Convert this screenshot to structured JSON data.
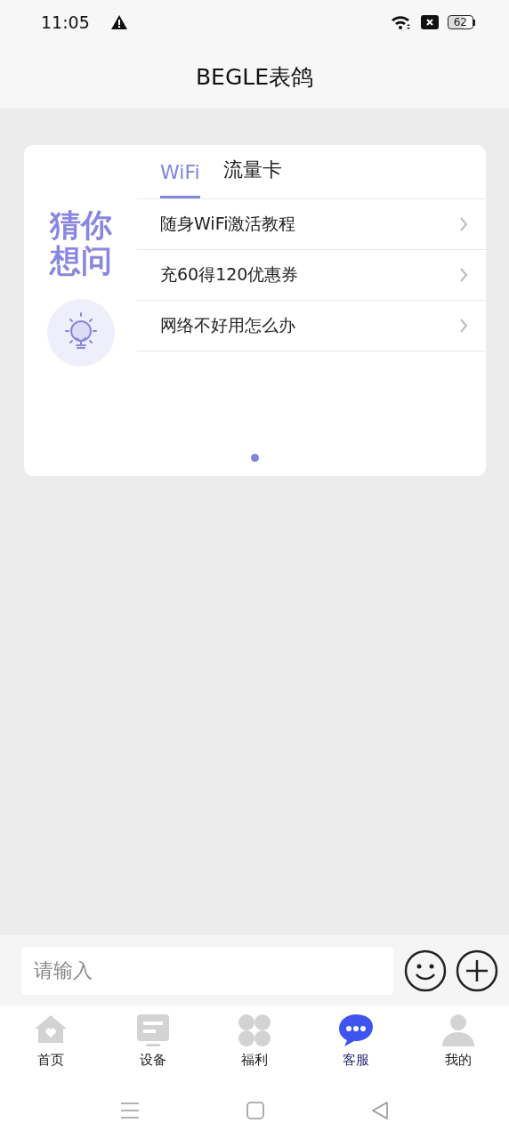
{
  "status_bar": {
    "time": "11:05",
    "battery": "62"
  },
  "header": {
    "title": "BEGLE表鸽"
  },
  "suggest_card": {
    "heading": "猜你想问",
    "tabs": [
      {
        "label": "WiFi",
        "selected": true
      },
      {
        "label": "流量卡",
        "selected": false
      }
    ],
    "items": [
      "随身WiFi激活教程",
      "充60得120优惠券",
      "网络不好用怎么办"
    ]
  },
  "composer": {
    "placeholder": "请输入"
  },
  "tab_bar": [
    {
      "label": "首页",
      "selected": false
    },
    {
      "label": "设备",
      "selected": false
    },
    {
      "label": "福利",
      "selected": false
    },
    {
      "label": "客服",
      "selected": true
    },
    {
      "label": "我的",
      "selected": false
    }
  ]
}
